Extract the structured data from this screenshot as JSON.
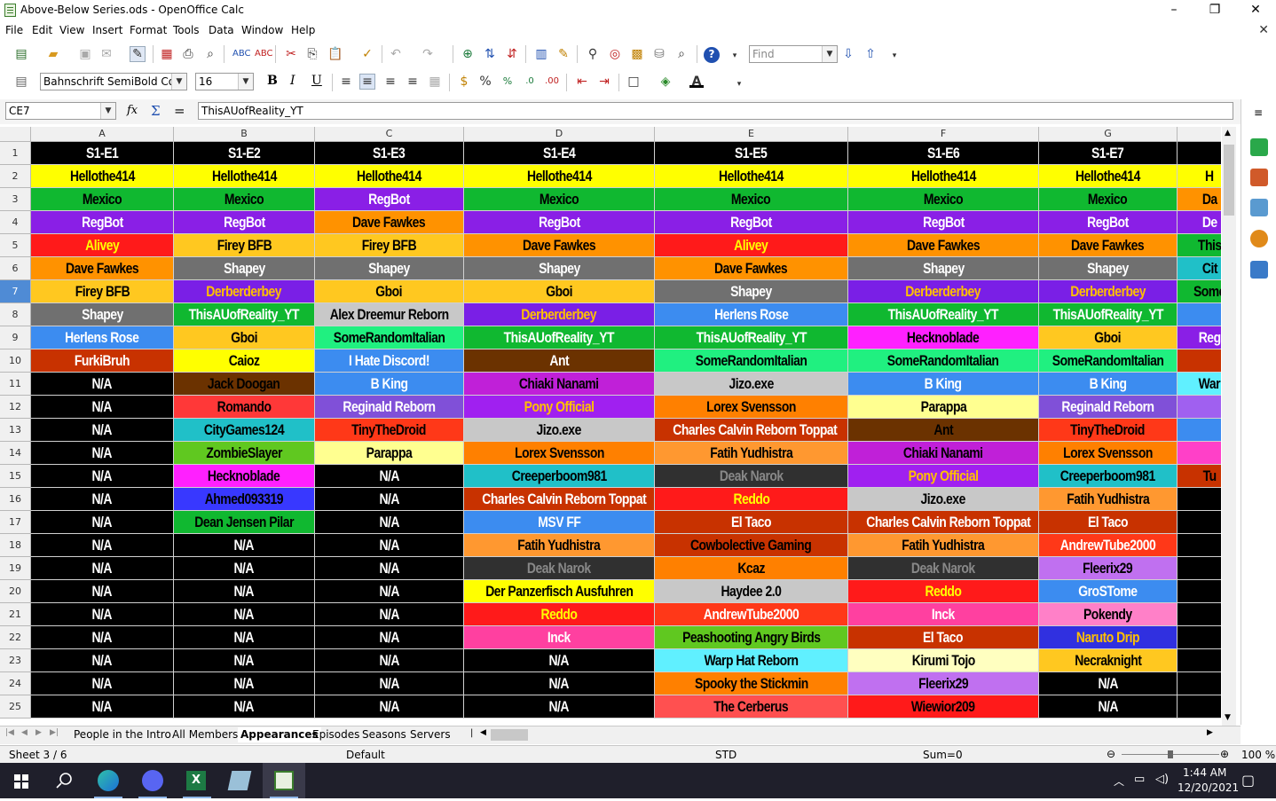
{
  "window": {
    "title": "Above-Below Series.ods - OpenOffice Calc",
    "minimize": "–",
    "maximize": "❐",
    "close": "✕",
    "doc_close": "✕"
  },
  "menu": [
    "File",
    "Edit",
    "View",
    "Insert",
    "Format",
    "Tools",
    "Data",
    "Window",
    "Help"
  ],
  "toolbar": {
    "find_placeholder": "Find",
    "font_name": "Bahnschrift SemiBold Cond",
    "font_size": "16",
    "bold": "B",
    "italic": "I",
    "underline": "U"
  },
  "formula": {
    "cell_ref": "CE7",
    "content": "ThisAUofReality_YT",
    "fx": "fx",
    "sigma": "Σ",
    "equals": "="
  },
  "grid": {
    "columns": [
      "A",
      "B",
      "C",
      "D",
      "E",
      "F",
      "G"
    ],
    "rows": [
      "1",
      "2",
      "3",
      "4",
      "5",
      "6",
      "7",
      "8",
      "9",
      "10",
      "11",
      "12",
      "13",
      "14",
      "15",
      "16",
      "17",
      "18",
      "19",
      "20",
      "21",
      "22",
      "23",
      "24",
      "25"
    ],
    "selected_row": "7",
    "cells": [
      [
        [
          "S1-E1",
          "#000000",
          "#ffffff"
        ],
        [
          "S1-E2",
          "#000000",
          "#ffffff"
        ],
        [
          "S1-E3",
          "#000000",
          "#ffffff"
        ],
        [
          "S1-E4",
          "#000000",
          "#ffffff"
        ],
        [
          "S1-E5",
          "#000000",
          "#ffffff"
        ],
        [
          "S1-E6",
          "#000000",
          "#ffffff"
        ],
        [
          "S1-E7",
          "#000000",
          "#ffffff"
        ],
        [
          "",
          "#000000",
          "#ffffff"
        ]
      ],
      [
        [
          "Hellothe414",
          "#ffff00",
          "#000000"
        ],
        [
          "Hellothe414",
          "#ffff00",
          "#000000"
        ],
        [
          "Hellothe414",
          "#ffff00",
          "#000000"
        ],
        [
          "Hellothe414",
          "#ffff00",
          "#000000"
        ],
        [
          "Hellothe414",
          "#ffff00",
          "#000000"
        ],
        [
          "Hellothe414",
          "#ffff00",
          "#000000"
        ],
        [
          "Hellothe414",
          "#ffff00",
          "#000000"
        ],
        [
          "H",
          "#ffff00",
          "#000000"
        ]
      ],
      [
        [
          "Mexico",
          "#10b830",
          "#000000"
        ],
        [
          "Mexico",
          "#10b830",
          "#000000"
        ],
        [
          "RegBot",
          "#8a1fe6",
          "#ffffff"
        ],
        [
          "Mexico",
          "#10b830",
          "#000000"
        ],
        [
          "Mexico",
          "#10b830",
          "#000000"
        ],
        [
          "Mexico",
          "#10b830",
          "#000000"
        ],
        [
          "Mexico",
          "#10b830",
          "#000000"
        ],
        [
          "Da",
          "#ff9200",
          "#000000"
        ]
      ],
      [
        [
          "RegBot",
          "#8a1fe6",
          "#ffffff"
        ],
        [
          "RegBot",
          "#8a1fe6",
          "#ffffff"
        ],
        [
          "Dave Fawkes",
          "#ff9200",
          "#000000"
        ],
        [
          "RegBot",
          "#8a1fe6",
          "#ffffff"
        ],
        [
          "RegBot",
          "#8a1fe6",
          "#ffffff"
        ],
        [
          "RegBot",
          "#8a1fe6",
          "#ffffff"
        ],
        [
          "RegBot",
          "#8a1fe6",
          "#ffffff"
        ],
        [
          "De",
          "#8a1fe6",
          "#ffffff"
        ]
      ],
      [
        [
          "Alivey",
          "#ff1a1a",
          "#ffff00"
        ],
        [
          "Firey BFB",
          "#ffc820",
          "#000000"
        ],
        [
          "Firey BFB",
          "#ffc820",
          "#000000"
        ],
        [
          "Dave Fawkes",
          "#ff9200",
          "#000000"
        ],
        [
          "Alivey",
          "#ff1a1a",
          "#ffff00"
        ],
        [
          "Dave Fawkes",
          "#ff9200",
          "#000000"
        ],
        [
          "Dave Fawkes",
          "#ff9200",
          "#000000"
        ],
        [
          "This",
          "#10b830",
          "#000000"
        ]
      ],
      [
        [
          "Dave Fawkes",
          "#ff9200",
          "#000000"
        ],
        [
          "Shapey",
          "#707070",
          "#ffffff"
        ],
        [
          "Shapey",
          "#707070",
          "#ffffff"
        ],
        [
          "Shapey",
          "#707070",
          "#ffffff"
        ],
        [
          "Dave Fawkes",
          "#ff9200",
          "#000000"
        ],
        [
          "Shapey",
          "#707070",
          "#ffffff"
        ],
        [
          "Shapey",
          "#707070",
          "#ffffff"
        ],
        [
          "Cit",
          "#20c0c8",
          "#000000"
        ]
      ],
      [
        [
          "Firey BFB",
          "#ffc820",
          "#000000"
        ],
        [
          "Derberderbey",
          "#7a1fe6",
          "#ffc000"
        ],
        [
          "Gboi",
          "#ffc820",
          "#000000"
        ],
        [
          "Gboi",
          "#ffc820",
          "#000000"
        ],
        [
          "Shapey",
          "#707070",
          "#ffffff"
        ],
        [
          "Derberderbey",
          "#7a1fe6",
          "#ffc000"
        ],
        [
          "Derberderbey",
          "#7a1fe6",
          "#ffc000"
        ],
        [
          "Some",
          "#10b830",
          "#000000"
        ]
      ],
      [
        [
          "Shapey",
          "#707070",
          "#ffffff"
        ],
        [
          "ThisAUofReality_YT",
          "#10b830",
          "#ffffff"
        ],
        [
          "Alex Dreemur Reborn",
          "#c8c8c8",
          "#000000"
        ],
        [
          "Derberderbey",
          "#7a1fe6",
          "#ffc000"
        ],
        [
          "Herlens Rose",
          "#3c8cf0",
          "#ffffff"
        ],
        [
          "ThisAUofReality_YT",
          "#10b830",
          "#ffffff"
        ],
        [
          "ThisAUofReality_YT",
          "#10b830",
          "#ffffff"
        ],
        [
          "",
          "#3c8cf0",
          "#ffffff"
        ]
      ],
      [
        [
          "Herlens Rose",
          "#3c8cf0",
          "#ffffff"
        ],
        [
          "Gboi",
          "#ffc820",
          "#000000"
        ],
        [
          "SomeRandomItalian",
          "#20f080",
          "#000000"
        ],
        [
          "ThisAUofReality_YT",
          "#10b830",
          "#ffffff"
        ],
        [
          "ThisAUofReality_YT",
          "#10b830",
          "#ffffff"
        ],
        [
          "Hecknoblade",
          "#ff20ff",
          "#000000"
        ],
        [
          "Gboi",
          "#ffc820",
          "#000000"
        ],
        [
          "Reg",
          "#8a1fe6",
          "#ffffff"
        ]
      ],
      [
        [
          "FurkiBruh",
          "#c83200",
          "#ffffff"
        ],
        [
          "Caioz",
          "#ffff00",
          "#000000"
        ],
        [
          "I Hate Discord!",
          "#3c8cf0",
          "#ffffff"
        ],
        [
          "Ant",
          "#6b3200",
          "#ffffff"
        ],
        [
          "SomeRandomItalian",
          "#20f080",
          "#000000"
        ],
        [
          "SomeRandomItalian",
          "#20f080",
          "#000000"
        ],
        [
          "SomeRandomItalian",
          "#20f080",
          "#000000"
        ],
        [
          "",
          "#c83200",
          "#ffffff"
        ]
      ],
      [
        [
          "N/A",
          "#000000",
          "#ffffff"
        ],
        [
          "Jack Doogan",
          "#6b3200",
          "#000000"
        ],
        [
          "B King",
          "#3c8cf0",
          "#ffffff"
        ],
        [
          "Chiaki Nanami",
          "#c020d8",
          "#000000"
        ],
        [
          "Jizo.exe",
          "#c8c8c8",
          "#000000"
        ],
        [
          "B King",
          "#3c8cf0",
          "#ffffff"
        ],
        [
          "B King",
          "#3c8cf0",
          "#ffffff"
        ],
        [
          "War",
          "#60f0ff",
          "#000000"
        ]
      ],
      [
        [
          "N/A",
          "#000000",
          "#ffffff"
        ],
        [
          "Romando",
          "#ff3838",
          "#000000"
        ],
        [
          "Reginald Reborn",
          "#8050d8",
          "#ffffff"
        ],
        [
          "Pony Official",
          "#a020f0",
          "#ffc000"
        ],
        [
          "Lorex Svensson",
          "#ff8000",
          "#000000"
        ],
        [
          "Parappa",
          "#ffff90",
          "#000000"
        ],
        [
          "Reginald Reborn",
          "#8050d8",
          "#ffffff"
        ],
        [
          "",
          "#a060f0",
          "#ffffff"
        ]
      ],
      [
        [
          "N/A",
          "#000000",
          "#ffffff"
        ],
        [
          "CityGames124",
          "#20c0c8",
          "#000000"
        ],
        [
          "TinyTheDroid",
          "#ff3818",
          "#000000"
        ],
        [
          "Jizo.exe",
          "#c8c8c8",
          "#000000"
        ],
        [
          "Charles Calvin Reborn Toppat",
          "#c83200",
          "#ffffff"
        ],
        [
          "Ant",
          "#6b3200",
          "#000000"
        ],
        [
          "TinyTheDroid",
          "#ff3818",
          "#000000"
        ],
        [
          "",
          "#3c8cf0",
          "#ffffff"
        ]
      ],
      [
        [
          "N/A",
          "#000000",
          "#ffffff"
        ],
        [
          "ZombieSlayer",
          "#60c820",
          "#000000"
        ],
        [
          "Parappa",
          "#ffff90",
          "#000000"
        ],
        [
          "Lorex Svensson",
          "#ff8000",
          "#000000"
        ],
        [
          "Fatih Yudhistra",
          "#ff9830",
          "#000000"
        ],
        [
          "Chiaki Nanami",
          "#c020d8",
          "#000000"
        ],
        [
          "Lorex Svensson",
          "#ff8000",
          "#000000"
        ],
        [
          "",
          "#ff40c8",
          "#ffffff"
        ]
      ],
      [
        [
          "N/A",
          "#000000",
          "#ffffff"
        ],
        [
          "Hecknoblade",
          "#ff20ff",
          "#000000"
        ],
        [
          "N/A",
          "#000000",
          "#ffffff"
        ],
        [
          "Creeperboom981",
          "#20c0c8",
          "#000000"
        ],
        [
          "Deak Narok",
          "#303030",
          "#888888"
        ],
        [
          "Pony Official",
          "#a020f0",
          "#ffc000"
        ],
        [
          "Creeperboom981",
          "#20c0c8",
          "#000000"
        ],
        [
          "Tu",
          "#c83200",
          "#000000"
        ]
      ],
      [
        [
          "N/A",
          "#000000",
          "#ffffff"
        ],
        [
          "Ahmed093319",
          "#3838ff",
          "#000000"
        ],
        [
          "N/A",
          "#000000",
          "#ffffff"
        ],
        [
          "Charles Calvin Reborn Toppat",
          "#c83200",
          "#ffffff"
        ],
        [
          "Reddo",
          "#ff1a1a",
          "#ffff00"
        ],
        [
          "Jizo.exe",
          "#c8c8c8",
          "#000000"
        ],
        [
          "Fatih Yudhistra",
          "#ff9830",
          "#000000"
        ],
        [
          "",
          "#000000",
          "#ffffff"
        ]
      ],
      [
        [
          "N/A",
          "#000000",
          "#ffffff"
        ],
        [
          "Dean Jensen Pilar",
          "#10b830",
          "#000000"
        ],
        [
          "N/A",
          "#000000",
          "#ffffff"
        ],
        [
          "MSV FF",
          "#3c8cf0",
          "#ffffff"
        ],
        [
          "El Taco",
          "#c83200",
          "#ffffff"
        ],
        [
          "Charles Calvin Reborn Toppat",
          "#c83200",
          "#ffffff"
        ],
        [
          "El Taco",
          "#c83200",
          "#ffffff"
        ],
        [
          "",
          "#000000",
          "#ffffff"
        ]
      ],
      [
        [
          "N/A",
          "#000000",
          "#ffffff"
        ],
        [
          "N/A",
          "#000000",
          "#ffffff"
        ],
        [
          "N/A",
          "#000000",
          "#ffffff"
        ],
        [
          "Fatih Yudhistra",
          "#ff9830",
          "#000000"
        ],
        [
          "Cowbolective Gaming",
          "#c83200",
          "#000000"
        ],
        [
          "Fatih Yudhistra",
          "#ff9830",
          "#000000"
        ],
        [
          "AndrewTube2000",
          "#ff3818",
          "#ffffff"
        ],
        [
          "",
          "#000000",
          "#ffffff"
        ]
      ],
      [
        [
          "N/A",
          "#000000",
          "#ffffff"
        ],
        [
          "N/A",
          "#000000",
          "#ffffff"
        ],
        [
          "N/A",
          "#000000",
          "#ffffff"
        ],
        [
          "Deak Narok",
          "#303030",
          "#888888"
        ],
        [
          "Kcaz",
          "#ff8000",
          "#000000"
        ],
        [
          "Deak Narok",
          "#303030",
          "#888888"
        ],
        [
          "Fleerix29",
          "#c070f0",
          "#000000"
        ],
        [
          "",
          "#000000",
          "#ffffff"
        ]
      ],
      [
        [
          "N/A",
          "#000000",
          "#ffffff"
        ],
        [
          "N/A",
          "#000000",
          "#ffffff"
        ],
        [
          "N/A",
          "#000000",
          "#ffffff"
        ],
        [
          "Der Panzerfisch Ausfuhren",
          "#ffff00",
          "#000000"
        ],
        [
          "Haydee 2.0",
          "#c8c8c8",
          "#000000"
        ],
        [
          "Reddo",
          "#ff1a1a",
          "#ffff00"
        ],
        [
          "GroSTome",
          "#3c8cf0",
          "#ffffff"
        ],
        [
          "",
          "#000000",
          "#ffffff"
        ]
      ],
      [
        [
          "N/A",
          "#000000",
          "#ffffff"
        ],
        [
          "N/A",
          "#000000",
          "#ffffff"
        ],
        [
          "N/A",
          "#000000",
          "#ffffff"
        ],
        [
          "Reddo",
          "#ff1a1a",
          "#ffff00"
        ],
        [
          "AndrewTube2000",
          "#ff3818",
          "#ffffff"
        ],
        [
          "Inck",
          "#ff40a0",
          "#ffffff"
        ],
        [
          "Pokendy",
          "#ff80c8",
          "#000000"
        ],
        [
          "",
          "#000000",
          "#ffffff"
        ]
      ],
      [
        [
          "N/A",
          "#000000",
          "#ffffff"
        ],
        [
          "N/A",
          "#000000",
          "#ffffff"
        ],
        [
          "N/A",
          "#000000",
          "#ffffff"
        ],
        [
          "Inck",
          "#ff40a0",
          "#ffffff"
        ],
        [
          "Peashooting Angry Birds",
          "#60c820",
          "#000000"
        ],
        [
          "El Taco",
          "#c83200",
          "#ffffff"
        ],
        [
          "Naruto Drip",
          "#3030e0",
          "#ffc000"
        ],
        [
          "",
          "#000000",
          "#ffffff"
        ]
      ],
      [
        [
          "N/A",
          "#000000",
          "#ffffff"
        ],
        [
          "N/A",
          "#000000",
          "#ffffff"
        ],
        [
          "N/A",
          "#000000",
          "#ffffff"
        ],
        [
          "N/A",
          "#000000",
          "#ffffff"
        ],
        [
          "Warp Hat Reborn",
          "#60f0ff",
          "#000000"
        ],
        [
          "Kirumi Tojo",
          "#ffffc0",
          "#000000"
        ],
        [
          "Necraknight",
          "#ffc820",
          "#000000"
        ],
        [
          "",
          "#000000",
          "#ffffff"
        ]
      ],
      [
        [
          "N/A",
          "#000000",
          "#ffffff"
        ],
        [
          "N/A",
          "#000000",
          "#ffffff"
        ],
        [
          "N/A",
          "#000000",
          "#ffffff"
        ],
        [
          "N/A",
          "#000000",
          "#ffffff"
        ],
        [
          "Spooky the Stickmin",
          "#ff8000",
          "#000000"
        ],
        [
          "Fleerix29",
          "#c070f0",
          "#000000"
        ],
        [
          "N/A",
          "#000000",
          "#ffffff"
        ],
        [
          "",
          "#000000",
          "#ffffff"
        ]
      ],
      [
        [
          "N/A",
          "#000000",
          "#ffffff"
        ],
        [
          "N/A",
          "#000000",
          "#ffffff"
        ],
        [
          "N/A",
          "#000000",
          "#ffffff"
        ],
        [
          "N/A",
          "#000000",
          "#ffffff"
        ],
        [
          "The Cerberus",
          "#ff5050",
          "#000000"
        ],
        [
          "Wiewior209",
          "#ff1a1a",
          "#000000"
        ],
        [
          "N/A",
          "#000000",
          "#ffffff"
        ],
        [
          "",
          "#000000",
          "#ffffff"
        ]
      ]
    ]
  },
  "sheet_tabs": [
    "People in the Intro",
    "All Members",
    "Appearances",
    "Episodes",
    "Seasons",
    "Servers"
  ],
  "active_tab": "Appearances",
  "status": {
    "sheet": "Sheet 3 / 6",
    "style": "Default",
    "mode": "STD",
    "sum": "Sum=0",
    "zoom": "100 %",
    "zoom_fraction": 0.5
  },
  "taskbar": {
    "time": "1:44 AM",
    "date": "12/20/2021"
  },
  "colors": {
    "selection": "#4f8bd5",
    "taskbar": "#1f1f2b"
  }
}
